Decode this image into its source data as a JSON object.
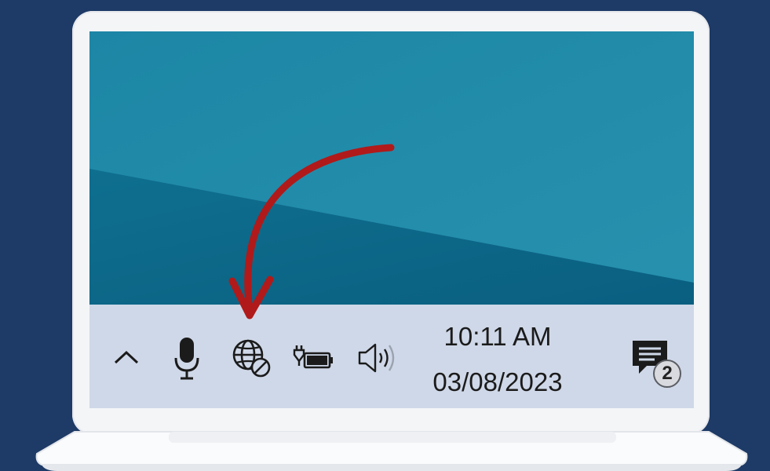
{
  "taskbar": {
    "clock": {
      "time": "10:11 AM",
      "date": "03/08/2023"
    },
    "notifications": {
      "count": "2"
    }
  },
  "icons": {
    "tray_overflow": "chevron-up-icon",
    "microphone": "microphone-icon",
    "network": "globe-no-internet-icon",
    "battery": "battery-charging-icon",
    "volume": "speaker-icon",
    "notifications": "notification-center-icon"
  },
  "colors": {
    "background": "#1e3a66",
    "wallpaper": "#1a7a9b",
    "taskbar": "#cfd8e8",
    "arrow": "#b01a1a"
  }
}
